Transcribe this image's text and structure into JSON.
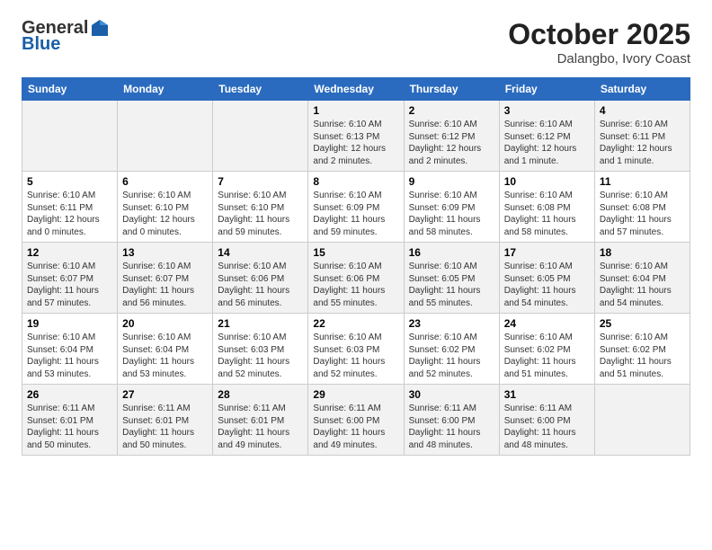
{
  "logo": {
    "general": "General",
    "blue": "Blue"
  },
  "header": {
    "month": "October 2025",
    "location": "Dalangbo, Ivory Coast"
  },
  "days_of_week": [
    "Sunday",
    "Monday",
    "Tuesday",
    "Wednesday",
    "Thursday",
    "Friday",
    "Saturday"
  ],
  "weeks": [
    [
      {
        "day": "",
        "info": ""
      },
      {
        "day": "",
        "info": ""
      },
      {
        "day": "",
        "info": ""
      },
      {
        "day": "1",
        "info": "Sunrise: 6:10 AM\nSunset: 6:13 PM\nDaylight: 12 hours and 2 minutes."
      },
      {
        "day": "2",
        "info": "Sunrise: 6:10 AM\nSunset: 6:12 PM\nDaylight: 12 hours and 2 minutes."
      },
      {
        "day": "3",
        "info": "Sunrise: 6:10 AM\nSunset: 6:12 PM\nDaylight: 12 hours and 1 minute."
      },
      {
        "day": "4",
        "info": "Sunrise: 6:10 AM\nSunset: 6:11 PM\nDaylight: 12 hours and 1 minute."
      }
    ],
    [
      {
        "day": "5",
        "info": "Sunrise: 6:10 AM\nSunset: 6:11 PM\nDaylight: 12 hours and 0 minutes."
      },
      {
        "day": "6",
        "info": "Sunrise: 6:10 AM\nSunset: 6:10 PM\nDaylight: 12 hours and 0 minutes."
      },
      {
        "day": "7",
        "info": "Sunrise: 6:10 AM\nSunset: 6:10 PM\nDaylight: 11 hours and 59 minutes."
      },
      {
        "day": "8",
        "info": "Sunrise: 6:10 AM\nSunset: 6:09 PM\nDaylight: 11 hours and 59 minutes."
      },
      {
        "day": "9",
        "info": "Sunrise: 6:10 AM\nSunset: 6:09 PM\nDaylight: 11 hours and 58 minutes."
      },
      {
        "day": "10",
        "info": "Sunrise: 6:10 AM\nSunset: 6:08 PM\nDaylight: 11 hours and 58 minutes."
      },
      {
        "day": "11",
        "info": "Sunrise: 6:10 AM\nSunset: 6:08 PM\nDaylight: 11 hours and 57 minutes."
      }
    ],
    [
      {
        "day": "12",
        "info": "Sunrise: 6:10 AM\nSunset: 6:07 PM\nDaylight: 11 hours and 57 minutes."
      },
      {
        "day": "13",
        "info": "Sunrise: 6:10 AM\nSunset: 6:07 PM\nDaylight: 11 hours and 56 minutes."
      },
      {
        "day": "14",
        "info": "Sunrise: 6:10 AM\nSunset: 6:06 PM\nDaylight: 11 hours and 56 minutes."
      },
      {
        "day": "15",
        "info": "Sunrise: 6:10 AM\nSunset: 6:06 PM\nDaylight: 11 hours and 55 minutes."
      },
      {
        "day": "16",
        "info": "Sunrise: 6:10 AM\nSunset: 6:05 PM\nDaylight: 11 hours and 55 minutes."
      },
      {
        "day": "17",
        "info": "Sunrise: 6:10 AM\nSunset: 6:05 PM\nDaylight: 11 hours and 54 minutes."
      },
      {
        "day": "18",
        "info": "Sunrise: 6:10 AM\nSunset: 6:04 PM\nDaylight: 11 hours and 54 minutes."
      }
    ],
    [
      {
        "day": "19",
        "info": "Sunrise: 6:10 AM\nSunset: 6:04 PM\nDaylight: 11 hours and 53 minutes."
      },
      {
        "day": "20",
        "info": "Sunrise: 6:10 AM\nSunset: 6:04 PM\nDaylight: 11 hours and 53 minutes."
      },
      {
        "day": "21",
        "info": "Sunrise: 6:10 AM\nSunset: 6:03 PM\nDaylight: 11 hours and 52 minutes."
      },
      {
        "day": "22",
        "info": "Sunrise: 6:10 AM\nSunset: 6:03 PM\nDaylight: 11 hours and 52 minutes."
      },
      {
        "day": "23",
        "info": "Sunrise: 6:10 AM\nSunset: 6:02 PM\nDaylight: 11 hours and 52 minutes."
      },
      {
        "day": "24",
        "info": "Sunrise: 6:10 AM\nSunset: 6:02 PM\nDaylight: 11 hours and 51 minutes."
      },
      {
        "day": "25",
        "info": "Sunrise: 6:10 AM\nSunset: 6:02 PM\nDaylight: 11 hours and 51 minutes."
      }
    ],
    [
      {
        "day": "26",
        "info": "Sunrise: 6:11 AM\nSunset: 6:01 PM\nDaylight: 11 hours and 50 minutes."
      },
      {
        "day": "27",
        "info": "Sunrise: 6:11 AM\nSunset: 6:01 PM\nDaylight: 11 hours and 50 minutes."
      },
      {
        "day": "28",
        "info": "Sunrise: 6:11 AM\nSunset: 6:01 PM\nDaylight: 11 hours and 49 minutes."
      },
      {
        "day": "29",
        "info": "Sunrise: 6:11 AM\nSunset: 6:00 PM\nDaylight: 11 hours and 49 minutes."
      },
      {
        "day": "30",
        "info": "Sunrise: 6:11 AM\nSunset: 6:00 PM\nDaylight: 11 hours and 48 minutes."
      },
      {
        "day": "31",
        "info": "Sunrise: 6:11 AM\nSunset: 6:00 PM\nDaylight: 11 hours and 48 minutes."
      },
      {
        "day": "",
        "info": ""
      }
    ]
  ]
}
